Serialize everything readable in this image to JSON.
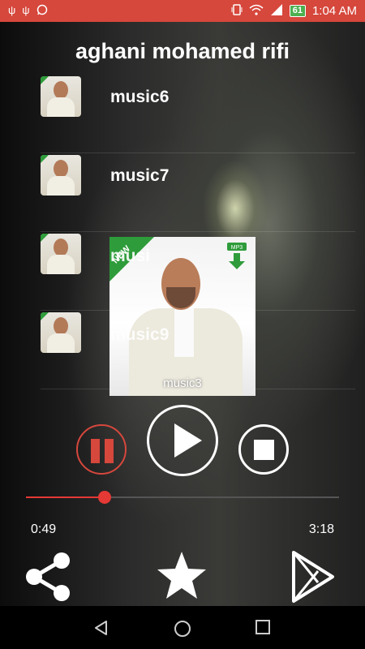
{
  "status_bar": {
    "time": "1:04 AM",
    "battery": "61",
    "notification_icons": [
      "usb-icon",
      "usb-icon",
      "whatsapp-icon"
    ],
    "system_icons": [
      "vibrate-icon",
      "wifi-icon",
      "signal-icon",
      "battery-icon"
    ]
  },
  "header": {
    "title": "aghani mohamed rifi"
  },
  "playlist": [
    {
      "label": "music6"
    },
    {
      "label": "music7"
    },
    {
      "label": "musi"
    },
    {
      "label": "music9"
    }
  ],
  "now_playing": {
    "cover_ribbon": "NEW",
    "cover_badge": "MP3",
    "caption": "music3"
  },
  "player": {
    "elapsed": "0:49",
    "duration": "3:18",
    "progress_fraction": 0.25
  },
  "colors": {
    "accent": "#d6473c",
    "progress": "#e53935",
    "thumb_ribbon": "#2e9c3a"
  }
}
